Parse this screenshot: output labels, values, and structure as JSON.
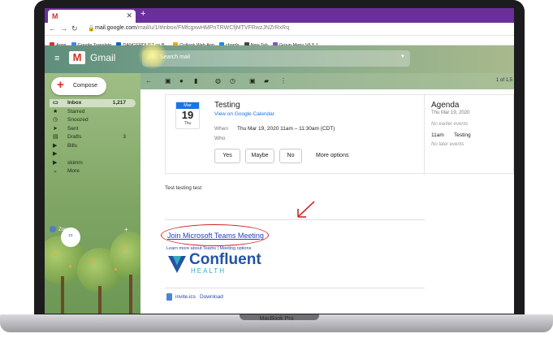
{
  "browser": {
    "tab_title": "",
    "tab_icon": "M",
    "url_domain": "mail.google.com",
    "url_path": "/mail/u/1/#inbox/FMfcgxwHMPnTRWCfjMTVFRwzJNZrRxRq",
    "bookmarks": [
      {
        "label": "Apps",
        "color": "#d93025"
      },
      {
        "label": "Google Translate",
        "color": "#4285f4"
      },
      {
        "label": "DANGERDUST on B...",
        "color": "#1565c0"
      },
      {
        "label": "Outlook Web App",
        "color": "#f4a60d"
      },
      {
        "label": "chords",
        "color": "#1e88e5"
      },
      {
        "label": "New Tab",
        "color": "#444444"
      },
      {
        "label": "Group Menu V6.5.1...",
        "color": "#7e57c2"
      }
    ]
  },
  "gmail": {
    "logo_text": "Gmail",
    "search_placeholder": "Search mail",
    "compose_label": "Compose",
    "nav": [
      {
        "icon": "▭",
        "label": "Inbox",
        "count": "1,217",
        "active": true
      },
      {
        "icon": "★",
        "label": "Starred",
        "count": ""
      },
      {
        "icon": "◷",
        "label": "Snoozed",
        "count": ""
      },
      {
        "icon": "➤",
        "label": "Sent",
        "count": ""
      },
      {
        "icon": "▤",
        "label": "Drafts",
        "count": "3"
      },
      {
        "icon": "▶",
        "label": "Bills",
        "count": ""
      },
      {
        "icon": "▶",
        "label": "",
        "count": ""
      },
      {
        "icon": "▶",
        "label": "skimm",
        "count": ""
      },
      {
        "icon": "⌄",
        "label": "More",
        "count": ""
      }
    ],
    "user_name": "Zoe",
    "pager": "1 of 1,5"
  },
  "event": {
    "month": "Mar",
    "day": "19",
    "dow": "Thu",
    "title": "Testing",
    "calendar_link": "View on Google Calendar",
    "when_label": "When",
    "when_value": "Thu Mar 19, 2020 11am – 11:30am (CDT)",
    "who_label": "Who",
    "rsvp": [
      "Yes",
      "Maybe",
      "No"
    ],
    "more_options": "More options"
  },
  "agenda": {
    "title": "Agenda",
    "date": "Thu Mar 19, 2020",
    "earlier": "No earlier events",
    "time": "11am",
    "event": "Testing",
    "later": "No later events"
  },
  "message": {
    "body_text": "Test testing test",
    "teams_link": "Join Microsoft Teams Meeting",
    "learn_more": "Learn more about Teams",
    "separator": " | ",
    "meeting_options": "Meeting options",
    "brand_name": "Confluent",
    "brand_sub": "HEALTH",
    "attachment": "invite.ics",
    "download": "Download",
    "annotation_color": "#d2232a"
  },
  "device_label": "MacBook Pro"
}
